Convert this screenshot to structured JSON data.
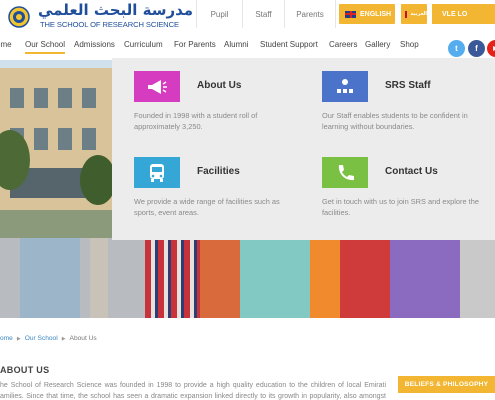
{
  "header": {
    "logo_arabic": "مدرسة البحث العلمي",
    "logo_english": "THE SCHOOL OF RESEARCH SCIENCE",
    "utility_links": [
      "Pupil",
      "Staff",
      "Parents"
    ],
    "lang_english": "ENGLISH",
    "lang_arabic": "العربية",
    "vle_login": "VLE LO"
  },
  "nav": {
    "items": [
      "ome",
      "Our School",
      "Admissions",
      "Curriculum",
      "For Parents",
      "Alumni",
      "Student Support",
      "Careers",
      "Gallery",
      "Shop"
    ],
    "active": "Our School"
  },
  "social": {
    "twitter": "t",
    "facebook": "f",
    "youtube": "▶"
  },
  "mega_menu": {
    "items": [
      {
        "title": "About Us",
        "description": "Founded in 1998 with a student roll of approximately 3,250.",
        "icon": "megaphone-icon",
        "color": "#d63cc0"
      },
      {
        "title": "SRS Staff",
        "description": "Our Staff enables students to be confident in learning without boundaries.",
        "icon": "staff-group-icon",
        "color": "#4a73c9"
      },
      {
        "title": "Facilities",
        "description": "We provide a wide range of facilities such as sports, event areas.",
        "icon": "bus-icon",
        "color": "#34a7d6"
      },
      {
        "title": "Contact Us",
        "description": "Get in touch with us to join SRS and explore the facilities.",
        "icon": "phone-icon",
        "color": "#7ac143"
      }
    ]
  },
  "breadcrumb": {
    "home": "ome",
    "our_school": "Our School",
    "current": "About Us"
  },
  "page": {
    "title": "ABOUT US",
    "body": "he School of Research Science was founded in 1998 to provide a high quality education to the children of local Emirati amilies. Since that time, the school has seen a dramatic expansion linked directly to its growth in popularity, also amongst non-",
    "side_button": "BELIEFS & PHILOSOPHY"
  }
}
